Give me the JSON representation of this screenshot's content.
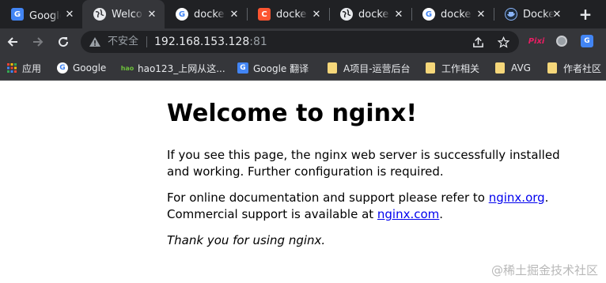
{
  "tabs": [
    {
      "title": "Google 翻译",
      "icon": "google-translate-icon"
    },
    {
      "title": "Welcome to nginx!",
      "icon": "globe-icon",
      "active": true
    },
    {
      "title": "docker",
      "icon": "google-icon"
    },
    {
      "title": "docker",
      "icon": "csdn-icon"
    },
    {
      "title": "docker",
      "icon": "globe-icon"
    },
    {
      "title": "docker",
      "icon": "google-icon"
    },
    {
      "title": "Docker",
      "icon": "docker-icon"
    }
  ],
  "tab_close_glyph": "✕",
  "new_tab_glyph": "+",
  "omnibox": {
    "security_label": "不安全",
    "host": "192.168.153.128",
    "port": ":81"
  },
  "extensions": {
    "pixi_label": "Pixi"
  },
  "bookmarks": [
    {
      "label": "应用",
      "icon": "apps-grid-icon"
    },
    {
      "label": "Google",
      "icon": "google-icon"
    },
    {
      "label": "hao123_上网从这...",
      "icon": "hao123-icon"
    },
    {
      "label": "Google 翻译",
      "icon": "google-translate-icon"
    },
    {
      "label": "A项目-运营后台",
      "icon": "folder-icon"
    },
    {
      "label": "工作相关",
      "icon": "folder-icon"
    },
    {
      "label": "AVG",
      "icon": "folder-icon"
    },
    {
      "label": "作者社区",
      "icon": "folder-icon"
    }
  ],
  "page": {
    "heading": "Welcome to nginx!",
    "p1": "If you see this page, the nginx web server is successfully installed and working. Further configuration is required.",
    "p2_prefix": "For online documentation and support please refer to ",
    "p2_link": "nginx.org",
    "p2_mid": ".",
    "p2_line2_prefix": "Commercial support is available at ",
    "p2_link2": "nginx.com",
    "p2_suffix": ".",
    "p3": "Thank you for using nginx."
  },
  "watermark": "@稀土掘金技术社区",
  "colors": {
    "tabstrip_bg": "#202124",
    "toolbar_bg": "#35363a",
    "link": "#0000ee",
    "csdn_red": "#fc5531"
  }
}
